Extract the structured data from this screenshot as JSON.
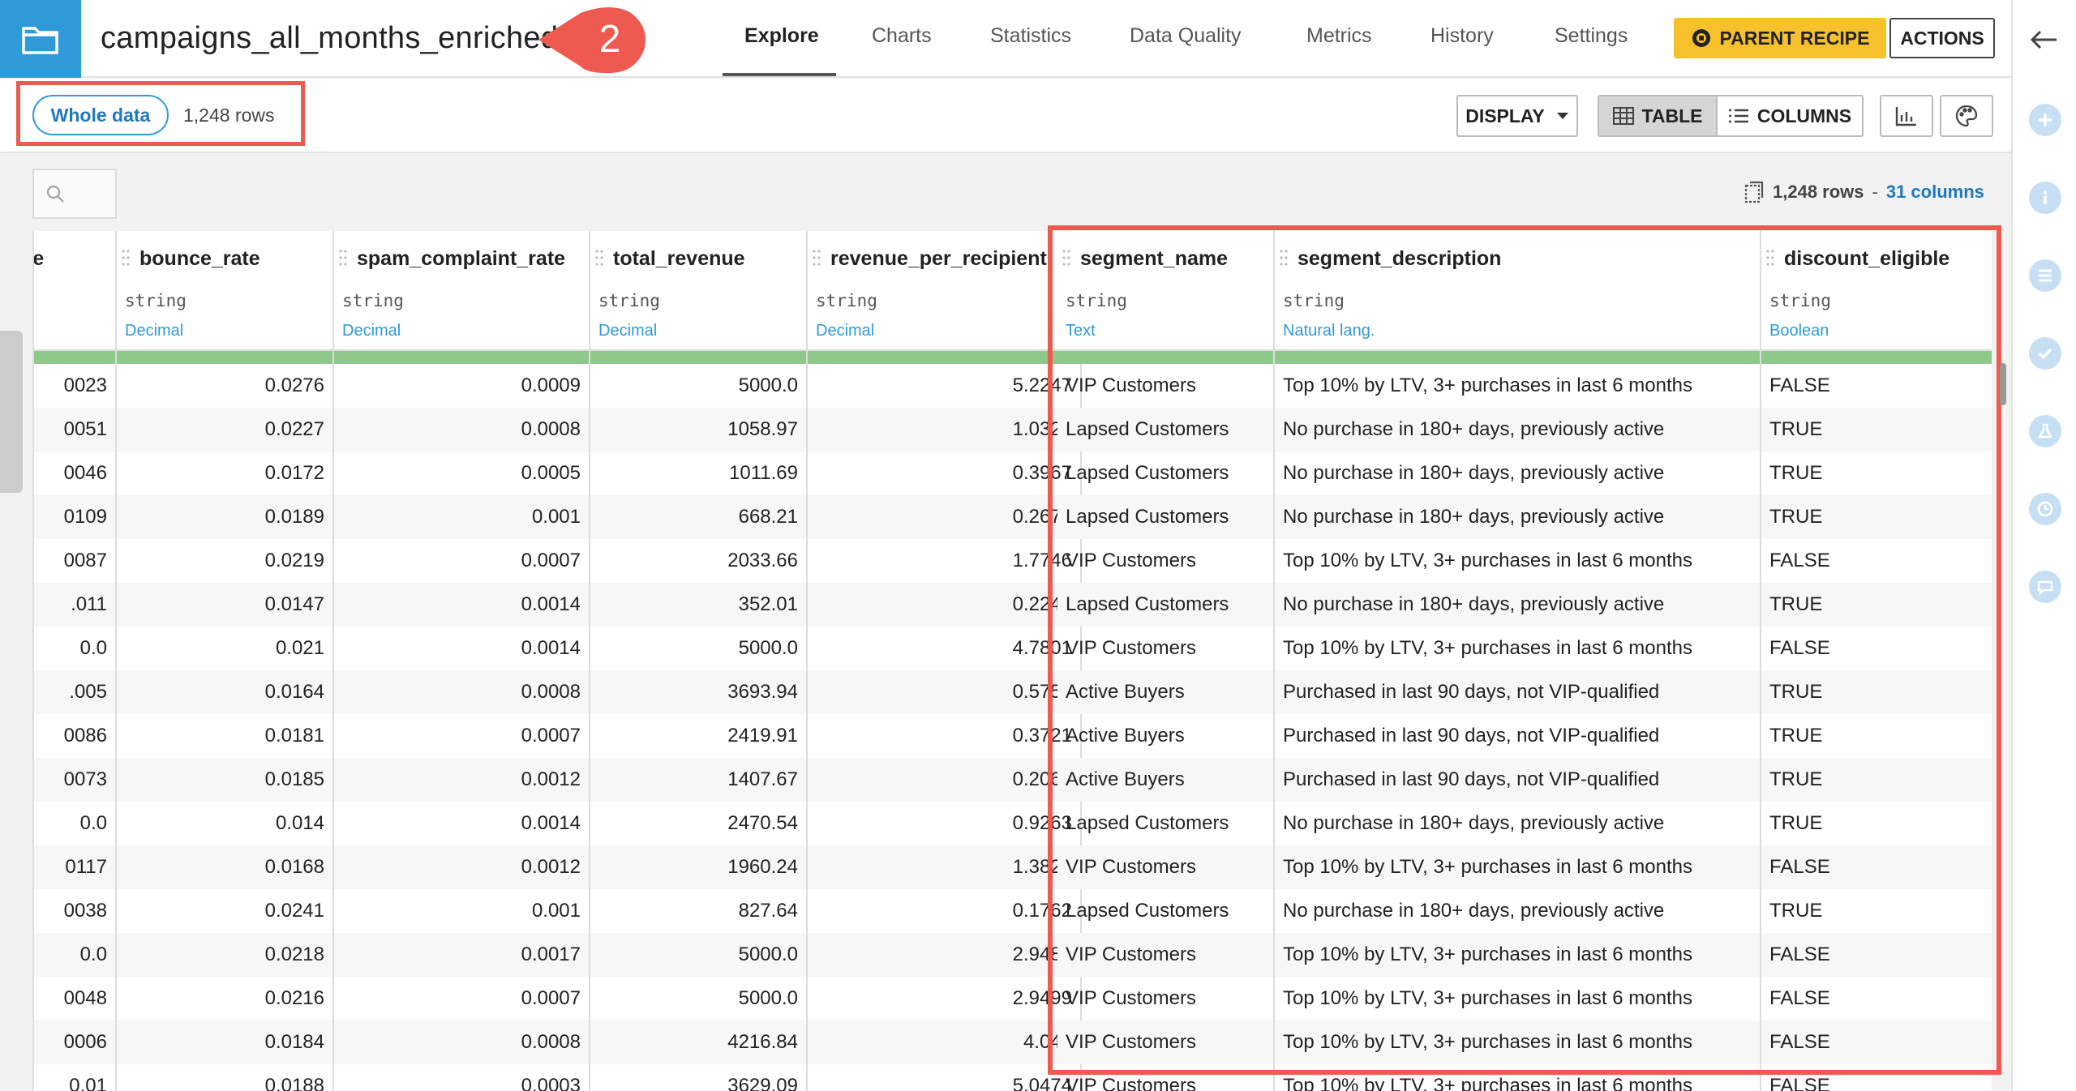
{
  "header": {
    "dataset_title": "campaigns_all_months_enriched",
    "step_number": "2",
    "tabs": [
      "Explore",
      "Charts",
      "Statistics",
      "Data Quality",
      "Metrics",
      "History",
      "Settings"
    ],
    "parent_recipe_label": "PARENT RECIPE",
    "actions_label": "ACTIONS"
  },
  "subheader": {
    "sample_label": "Whole data",
    "rows_label": "1,248 rows",
    "display_label": "DISPLAY",
    "table_label": "TABLE",
    "columns_label": "COLUMNS"
  },
  "meta": {
    "rows": "1,248 rows",
    "separator": "-",
    "columns": "31 columns"
  },
  "colors": {
    "accent": "#2e9ad8",
    "highlight": "#ee5a4f",
    "parent_recipe": "#f7c02d",
    "quality_ok": "#8dc98a"
  },
  "columns": [
    {
      "name": "",
      "type": "",
      "meaning": "",
      "numeric": true,
      "values": [
        "0023",
        "0051",
        "0046",
        "0109",
        "0087",
        ".011",
        "0.0",
        ".005",
        "0086",
        "0073",
        "0.0",
        "0117",
        "0038",
        "0.0",
        "0048",
        "0006",
        "0.01"
      ]
    },
    {
      "name": "bounce_rate",
      "type": "string",
      "meaning": "Decimal",
      "numeric": true,
      "values": [
        "0.0276",
        "0.0227",
        "0.0172",
        "0.0189",
        "0.0219",
        "0.0147",
        "0.021",
        "0.0164",
        "0.0181",
        "0.0185",
        "0.014",
        "0.0168",
        "0.0241",
        "0.0218",
        "0.0216",
        "0.0184",
        "0.0188"
      ]
    },
    {
      "name": "spam_complaint_rate",
      "type": "string",
      "meaning": "Decimal",
      "numeric": true,
      "values": [
        "0.0009",
        "0.0008",
        "0.0005",
        "0.001",
        "0.0007",
        "0.0014",
        "0.0014",
        "0.0008",
        "0.0007",
        "0.0012",
        "0.0014",
        "0.0012",
        "0.001",
        "0.0017",
        "0.0007",
        "0.0008",
        "0.0003"
      ]
    },
    {
      "name": "total_revenue",
      "type": "string",
      "meaning": "Decimal",
      "numeric": true,
      "values": [
        "5000.0",
        "1058.97",
        "1011.69",
        "668.21",
        "2033.66",
        "352.01",
        "5000.0",
        "3693.94",
        "2419.91",
        "1407.67",
        "2470.54",
        "1960.24",
        "827.64",
        "5000.0",
        "5000.0",
        "4216.84",
        "3629.09"
      ]
    },
    {
      "name": "revenue_per_recipient",
      "type": "string",
      "meaning": "Decimal",
      "numeric": true,
      "values": [
        "5.2247",
        "1.0321",
        "0.3967",
        "0.2679",
        "1.7746",
        "0.2248",
        "4.7801",
        "0.5756",
        "0.3721",
        "0.2064",
        "0.9263",
        "1.3824",
        "0.1762",
        "2.9481",
        "2.9499",
        "4.043",
        "5.0474"
      ]
    },
    {
      "name": "segment_name",
      "type": "string",
      "meaning": "Text",
      "numeric": false,
      "values": [
        "VIP Customers",
        "Lapsed Customers",
        "Lapsed Customers",
        "Lapsed Customers",
        "VIP Customers",
        "Lapsed Customers",
        "VIP Customers",
        "Active Buyers",
        "Active Buyers",
        "Active Buyers",
        "Lapsed Customers",
        "VIP Customers",
        "Lapsed Customers",
        "VIP Customers",
        "VIP Customers",
        "VIP Customers",
        "VIP Customers"
      ]
    },
    {
      "name": "segment_description",
      "type": "string",
      "meaning": "Natural lang.",
      "numeric": false,
      "values": [
        "Top 10% by LTV, 3+ purchases in last 6 months",
        "No purchase in 180+ days, previously active",
        "No purchase in 180+ days, previously active",
        "No purchase in 180+ days, previously active",
        "Top 10% by LTV, 3+ purchases in last 6 months",
        "No purchase in 180+ days, previously active",
        "Top 10% by LTV, 3+ purchases in last 6 months",
        "Purchased in last 90 days, not VIP-qualified",
        "Purchased in last 90 days, not VIP-qualified",
        "Purchased in last 90 days, not VIP-qualified",
        "No purchase in 180+ days, previously active",
        "Top 10% by LTV, 3+ purchases in last 6 months",
        "No purchase in 180+ days, previously active",
        "Top 10% by LTV, 3+ purchases in last 6 months",
        "Top 10% by LTV, 3+ purchases in last 6 months",
        "Top 10% by LTV, 3+ purchases in last 6 months",
        "Top 10% by LTV, 3+ purchases in last 6 months"
      ]
    },
    {
      "name": "discount_eligible",
      "type": "string",
      "meaning": "Boolean",
      "numeric": false,
      "values": [
        "FALSE",
        "TRUE",
        "TRUE",
        "TRUE",
        "FALSE",
        "TRUE",
        "FALSE",
        "TRUE",
        "TRUE",
        "TRUE",
        "TRUE",
        "FALSE",
        "TRUE",
        "FALSE",
        "FALSE",
        "FALSE",
        "FALSE"
      ]
    }
  ]
}
